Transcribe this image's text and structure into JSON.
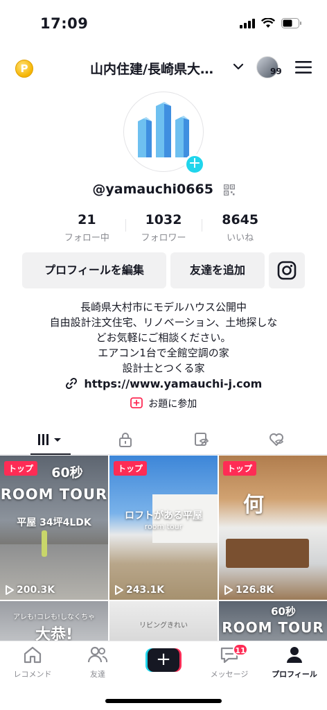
{
  "status_bar": {
    "time": "17:09"
  },
  "header": {
    "coin_icon": "coin-icon",
    "coin_letter": "P",
    "title": "山内住建/長崎県大…",
    "avatar_count": "99"
  },
  "profile": {
    "username": "@yamauchi0665",
    "stats": [
      {
        "number": "21",
        "label": "フォロー中"
      },
      {
        "number": "1032",
        "label": "フォロワー"
      },
      {
        "number": "8645",
        "label": "いいね"
      }
    ],
    "edit_button": "プロフィールを編集",
    "add_friend_button": "友達を追加",
    "bio_lines": [
      "長崎県大村市にモデルハウス公開中",
      "自由設計注文住宅、リノベーション、土地探しな",
      "どお気軽にご相談ください。",
      "エアコン1台で全館空調の家",
      "設計士とつくる家"
    ],
    "link": "https://www.yamauchi-j.com",
    "topic": "お題に参加"
  },
  "videos": [
    {
      "badge": "トップ",
      "views": "200.3K",
      "overlay_top": "60秒",
      "overlay_main": "ROOM TOUR",
      "overlay_sub": "平屋 34坪4LDK"
    },
    {
      "badge": "トップ",
      "views": "243.1K",
      "overlay_main": "ロフトがある平屋",
      "overlay_sub": "room tour"
    },
    {
      "badge": "トップ",
      "views": "126.8K",
      "overlay_main": "何"
    },
    {
      "overlay_top": "アレも!コレも!しなくちゃ",
      "overlay_main": "大恭!"
    },
    {
      "overlay_top": "リビングきれい"
    },
    {
      "overlay_top": "60秒",
      "overlay_main": "ROOM TOUR"
    }
  ],
  "bottom_nav": {
    "items": [
      {
        "label": "レコメンド"
      },
      {
        "label": "友達"
      },
      {
        "label": "メッセージ"
      },
      {
        "label": "プロフィール"
      }
    ],
    "message_badge": "11"
  },
  "colors": {
    "accent": "#fe2c55",
    "cyan": "#20d5ec",
    "text": "#161823",
    "muted": "#8a8b91"
  }
}
